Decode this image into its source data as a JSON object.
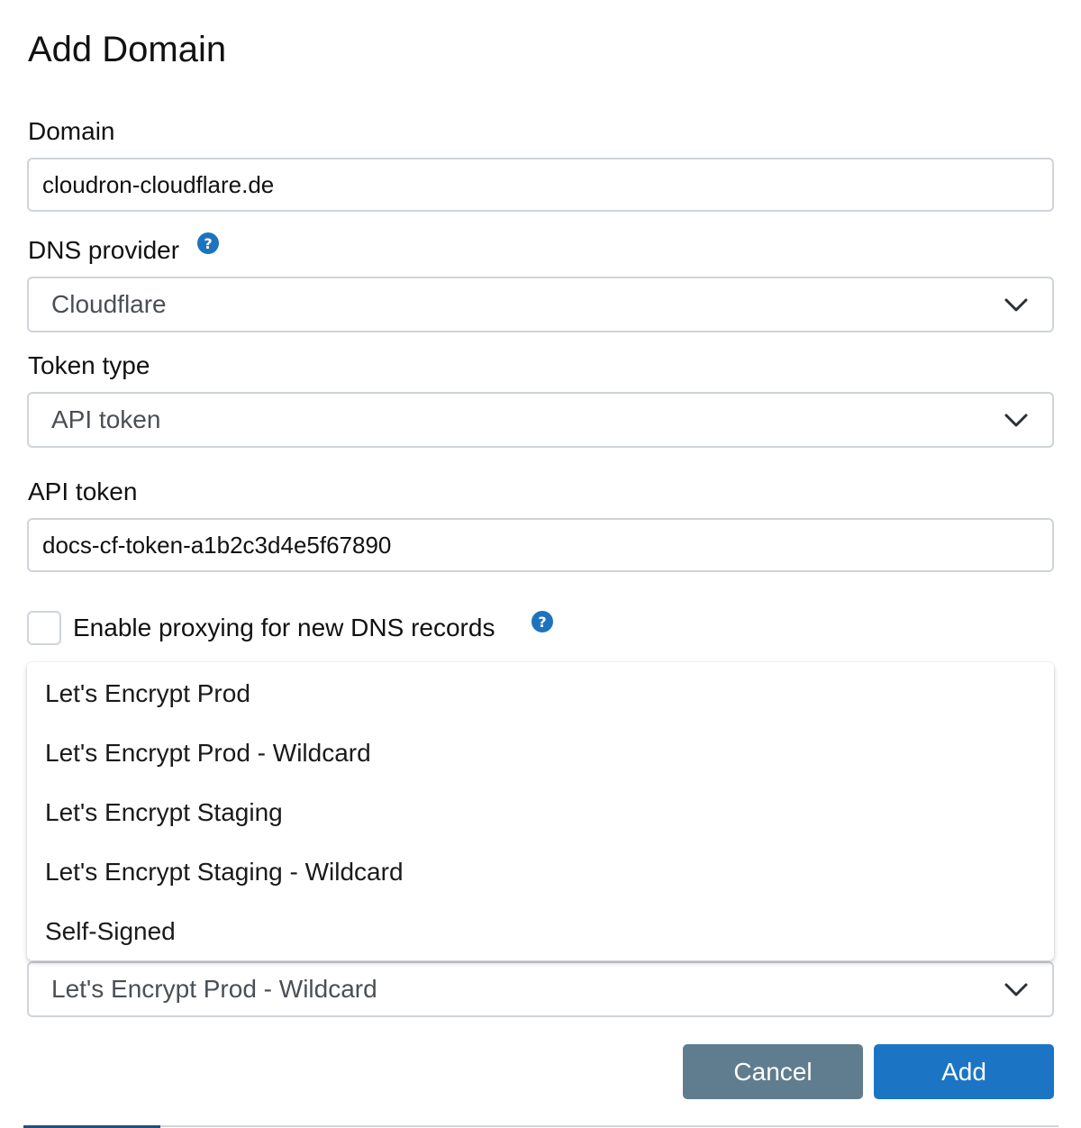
{
  "dialog": {
    "title": "Add Domain"
  },
  "domain": {
    "label": "Domain",
    "value": "cloudron-cloudflare.de"
  },
  "dns_provider": {
    "label": "DNS provider",
    "help_icon": "question-icon",
    "selected": "Cloudflare"
  },
  "token_type": {
    "label": "Token type",
    "selected": "API token"
  },
  "api_token": {
    "label": "API token",
    "value": "docs-cf-token-a1b2c3d4e5f67890"
  },
  "proxying": {
    "label": "Enable proxying for new DNS records",
    "checked": false,
    "help_icon": "question-icon"
  },
  "certificate_provider": {
    "selected": "Let's Encrypt Prod - Wildcard",
    "options": [
      "Let's Encrypt Prod",
      "Let's Encrypt Prod - Wildcard",
      "Let's Encrypt Staging",
      "Let's Encrypt Staging - Wildcard",
      "Self-Signed"
    ]
  },
  "actions": {
    "cancel_label": "Cancel",
    "add_label": "Add"
  },
  "colors": {
    "accent": "#1b75c4",
    "cancel": "#5f7d8e",
    "border": "#cfd4d9"
  }
}
